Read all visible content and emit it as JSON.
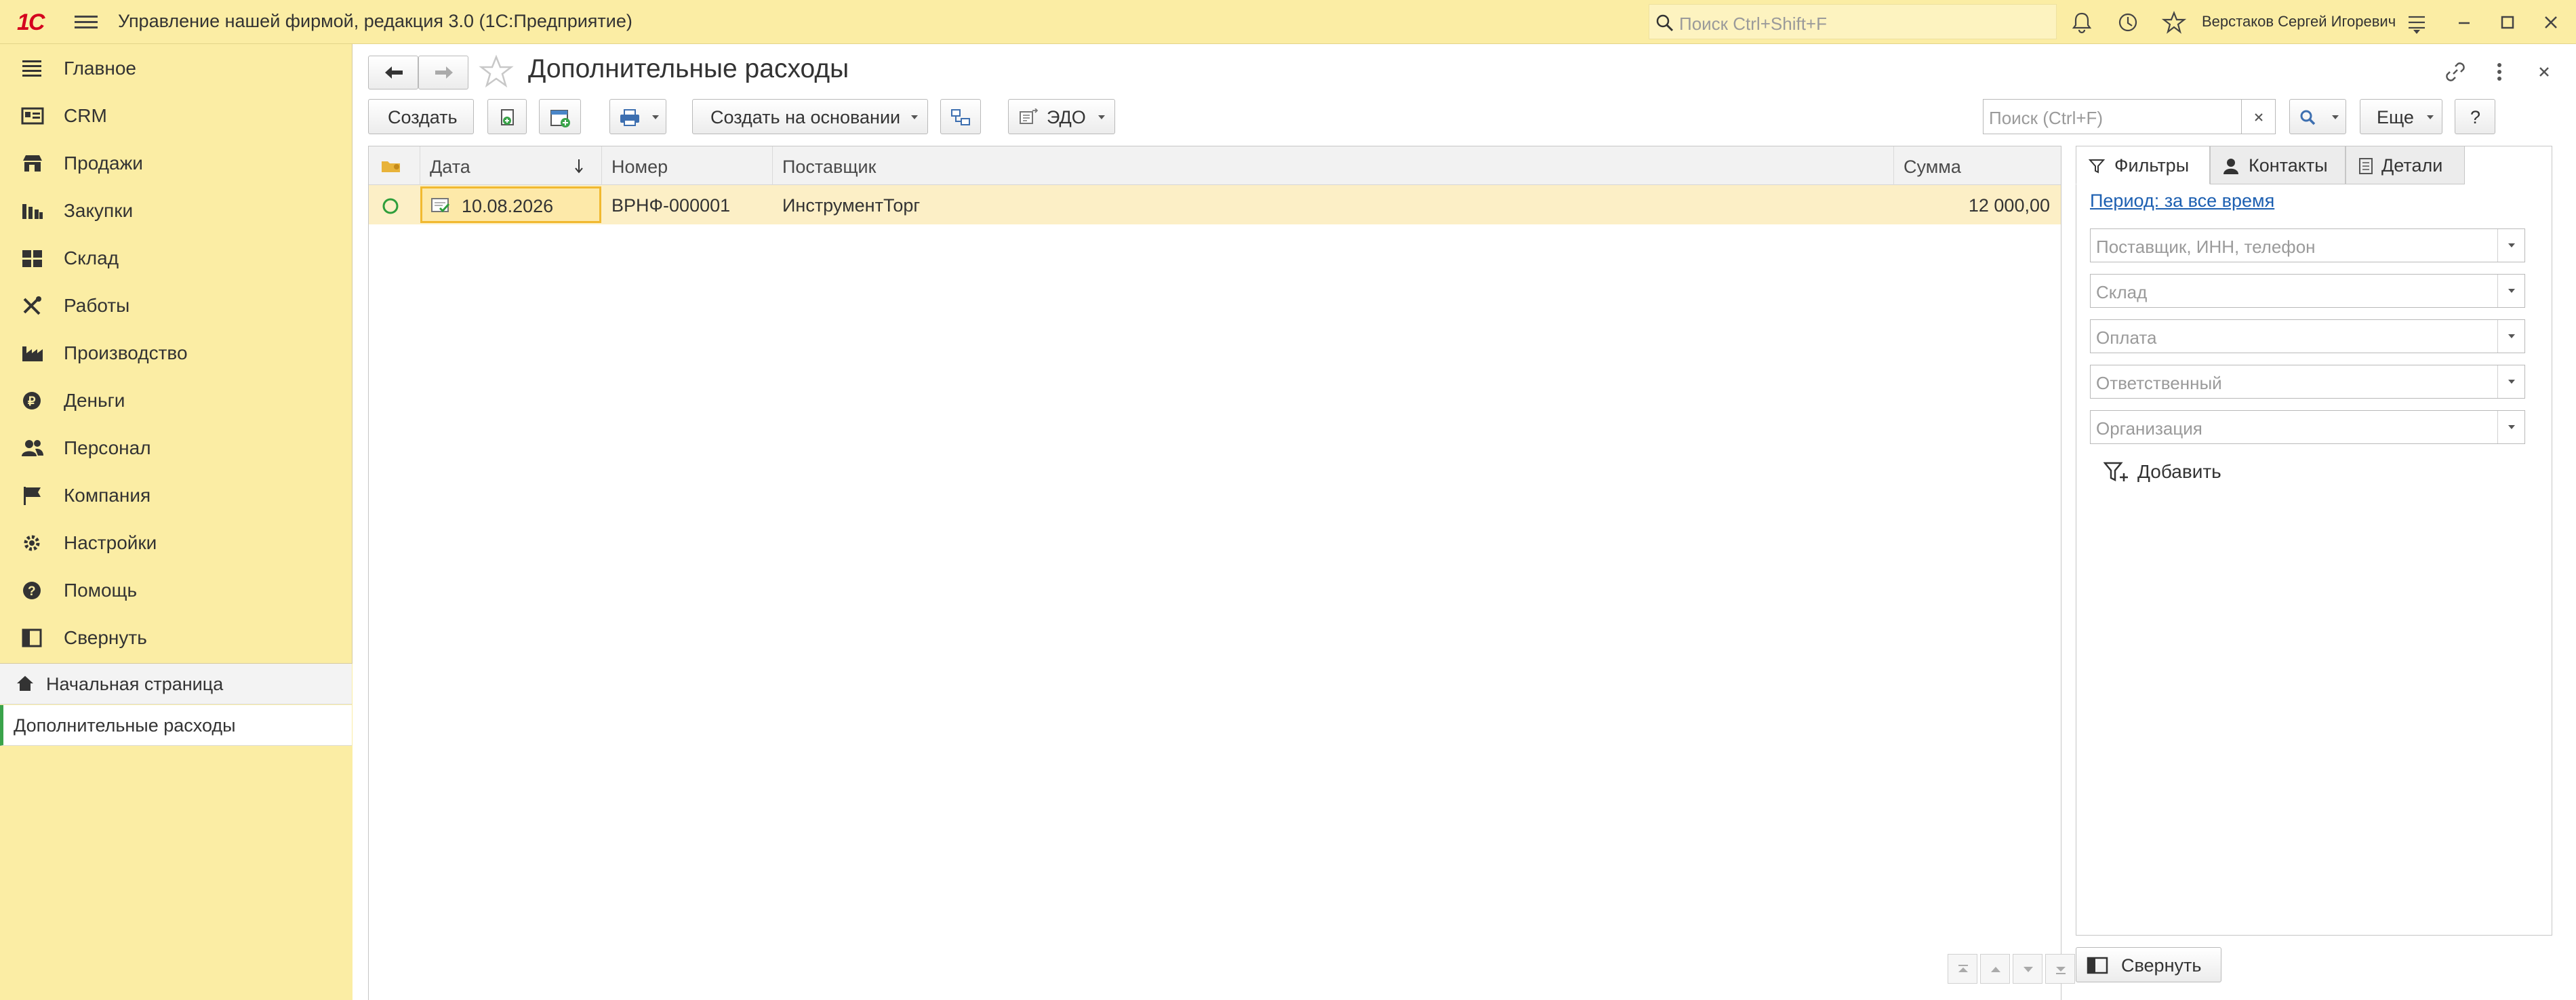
{
  "titlebar": {
    "logo": "1С",
    "app_title": "Управление нашей фирмой, редакция 3.0  (1С:Предприятие)",
    "search_placeholder": "Поиск Ctrl+Shift+F",
    "user_name": "Верстаков Сергей Игоревич"
  },
  "sidebar": {
    "items": [
      {
        "label": "Главное",
        "icon": "menu-lines-icon"
      },
      {
        "label": "CRM",
        "icon": "crm-card-icon"
      },
      {
        "label": "Продажи",
        "icon": "shop-icon"
      },
      {
        "label": "Закупки",
        "icon": "purchase-icon"
      },
      {
        "label": "Склад",
        "icon": "warehouse-grid-icon"
      },
      {
        "label": "Работы",
        "icon": "tools-icon"
      },
      {
        "label": "Производство",
        "icon": "factory-icon"
      },
      {
        "label": "Деньги",
        "icon": "ruble-coin-icon"
      },
      {
        "label": "Персонал",
        "icon": "people-icon"
      },
      {
        "label": "Компания",
        "icon": "flag-icon"
      },
      {
        "label": "Настройки",
        "icon": "gear-icon"
      },
      {
        "label": "Помощь",
        "icon": "help-icon"
      },
      {
        "label": "Свернуть",
        "icon": "collapse-panel-icon"
      }
    ],
    "open_tabs": {
      "home": "Начальная страница",
      "current": "Дополнительные расходы"
    }
  },
  "form": {
    "title": "Дополнительные расходы",
    "toolbar": {
      "create": "Создать",
      "create_based_on": "Создать на основании",
      "edo": "ЭДО",
      "more": "Еще",
      "help": "?"
    },
    "search_placeholder": "Поиск (Ctrl+F)",
    "table": {
      "columns": [
        "Дата",
        "Номер",
        "Поставщик",
        "Сумма"
      ],
      "rows": [
        {
          "date": "10.08.2026",
          "number": "ВРНФ-000001",
          "supplier": "ИнструментТорг",
          "sum": "12 000,00"
        }
      ]
    },
    "right_panel": {
      "tabs": [
        "Фильтры",
        "Контакты",
        "Детали"
      ],
      "period_link": "Период: за все время",
      "filters": [
        "Поставщик, ИНН, телефон",
        "Склад",
        "Оплата",
        "Ответственный",
        "Организация"
      ],
      "add_label": "Добавить",
      "collapse_label": "Свернуть"
    }
  },
  "colors": {
    "titlebar_bg": "#fbeda4",
    "selected_row": "#fcefc6",
    "active_cell_border": "#f1b930",
    "link": "#1c5fb1",
    "logo_red": "#d4001e"
  }
}
